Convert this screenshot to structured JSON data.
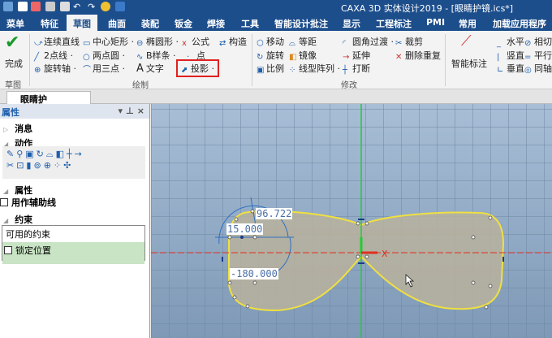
{
  "window": {
    "title": "CAXA 3D 实体设计2019 - [眼睛护镜.ics*]"
  },
  "menu_tabs": [
    "菜单",
    "特征",
    "草图",
    "曲面",
    "装配",
    "钣金",
    "焊接",
    "工具",
    "智能设计批注",
    "显示",
    "工程标注",
    "PMI",
    "常用",
    "加载应用程序"
  ],
  "ribbon": {
    "finish": "完成",
    "sketch_group": "草图",
    "draw": {
      "items": [
        "连续直线",
        "中心矩形 ·",
        "椭圆形 ·",
        "公式",
        "构造",
        "2点线 ·",
        "两点圆 ·",
        "B样条 ·",
        "点",
        "旋转轴 ·",
        "用三点 ·",
        "文字",
        "投影 ·"
      ],
      "group": "绘制"
    },
    "modify": {
      "items": [
        "移动",
        "等距",
        "圆角过渡 ·",
        "裁剪",
        "旋转",
        "镜像",
        "延伸",
        "删除重复",
        "比例",
        "线型阵列 ·",
        "打断"
      ],
      "group": "修改"
    },
    "constraint": {
      "smart_dim": "智能标注",
      "items": [
        "水平",
        "相切",
        "竖直",
        "平行",
        "垂直",
        "同轴"
      ]
    }
  },
  "document_tab": {
    "label": "眼睛护镜.ics*"
  },
  "panel": {
    "title": "属性",
    "sections": {
      "message": "消息",
      "action": "动作",
      "property": "属性",
      "constraint": "约束"
    },
    "aux_line": "用作辅助线",
    "constraint_header": "可用的约束",
    "lock_position": "锁定位置"
  },
  "canvas": {
    "dims": [
      "96.722",
      "15.000",
      "-180.000"
    ],
    "axis_label": "X"
  },
  "colors": {
    "title_bar": "#1d4e8c",
    "outline": "#f0e040",
    "highlight": "#e02020"
  }
}
